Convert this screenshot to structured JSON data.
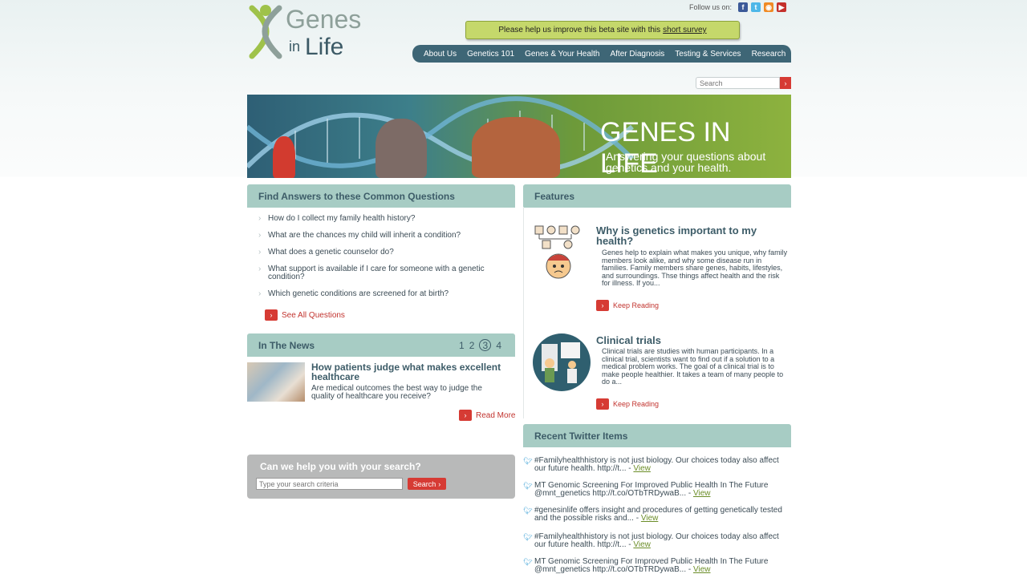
{
  "follow": {
    "label": "Follow us on:",
    "icons": [
      "facebook-icon",
      "twitter-icon",
      "rss-icon",
      "youtube-icon"
    ]
  },
  "survey": {
    "text": "Please help us improve this beta site with this",
    "link": "short survey"
  },
  "nav": {
    "items": [
      "About Us",
      "Genetics 101",
      "Genes & Your Health",
      "After Diagnosis",
      "Testing & Services",
      "Research"
    ]
  },
  "search_top": {
    "placeholder": "Search"
  },
  "logo": {
    "genes": "Genes",
    "in": "in",
    "life": "Life"
  },
  "banner": {
    "title": "GENES IN LIFE",
    "subtitle": "Answering your questions about genetics and your health."
  },
  "faq": {
    "heading": "Find Answers to these Common Questions",
    "items": [
      "How do I collect my family health history?",
      "What are the chances my child will inherit a condition?",
      "What does a genetic counselor do?",
      "What support is available if I care for someone with a genetic condition?",
      "Which genetic conditions are screened for at birth?"
    ],
    "see_all": "See All Questions"
  },
  "news": {
    "heading": "In The News",
    "pages": [
      "1",
      "2",
      "3",
      "4"
    ],
    "current_page": "3",
    "title": "How patients judge what makes excellent healthcare",
    "desc": "Are medical outcomes the best way to judge the quality of healthcare you receive?",
    "read_more": "Read More"
  },
  "help": {
    "heading": "Can we help you with your search?",
    "placeholder": "Type your search criteria",
    "button": "Search"
  },
  "features": {
    "heading": "Features",
    "items": [
      {
        "title": "Why is genetics important to my health?",
        "text": "Genes help to explain what makes you unique, why family members look alike, and why some disease run in families. Family members share genes, habits, lifestyles, and surroundings. Thse things affect health and the risk for illness. If you...",
        "link": "Keep Reading"
      },
      {
        "title": "Clinical trials",
        "text": "Clinical trials are studies with human participants. In a clinical trial, scientists want to find out if a solution to a medical problem works. The goal of a clinical trial is to make people healthier. It takes a team of many people to do a...",
        "link": "Keep Reading"
      }
    ]
  },
  "twitter": {
    "heading": "Recent Twitter Items",
    "view_label": "View",
    "items": [
      "#Familyhealthhistory is not just biology. Our choices today also affect our future health. http://t... -",
      "MT Genomic Screening For Improved Public Health In The Future @mnt_genetics http://t.co/OTbTRDywaB... -",
      "#genesinlife offers insight and procedures of getting genetically tested and the possible risks and... -",
      "#Familyhealthhistory is not just biology. Our choices today also affect our future health. http://t... -",
      "MT Genomic Screening For Improved Public Health In The Future @mnt_genetics http://t.co/OTbTRDywaB... -"
    ]
  },
  "colors": {
    "accent_red": "#d63b34",
    "header_teal": "#3e6676",
    "panel_head": "#a7ccc4",
    "survey_green": "#c5d86b"
  }
}
